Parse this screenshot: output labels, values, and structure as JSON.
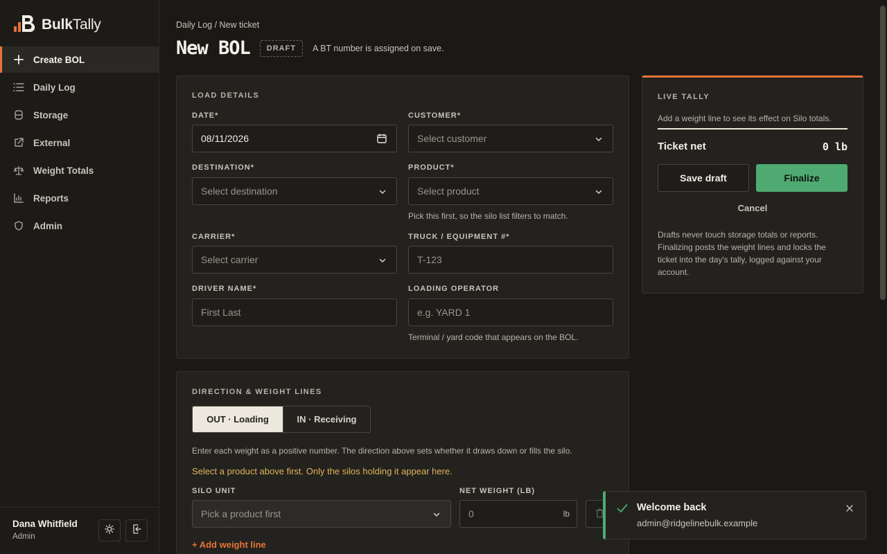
{
  "app": {
    "brand_bold": "Bulk",
    "brand_light": "Tally",
    "logo_icon": "bulktally-logo"
  },
  "nav": {
    "items": [
      {
        "label": "Create BOL",
        "icon": "plus-icon",
        "active": true
      },
      {
        "label": "Daily Log",
        "icon": "list-icon"
      },
      {
        "label": "Storage",
        "icon": "database-icon"
      },
      {
        "label": "External",
        "icon": "external-link-icon"
      },
      {
        "label": "Weight Totals",
        "icon": "scale-icon"
      },
      {
        "label": "Reports",
        "icon": "bar-chart-icon"
      },
      {
        "label": "Admin",
        "icon": "shield-icon"
      }
    ]
  },
  "user": {
    "name": "Dana Whitfield",
    "role": "Admin"
  },
  "page": {
    "breadcrumb": "Daily Log / New ticket",
    "title": "New BOL",
    "badge": "DRAFT",
    "note": "A BT number is assigned on save."
  },
  "load": {
    "section_title": "LOAD DETAILS",
    "date_label": "DATE*",
    "date_value": "08/11/2026",
    "customer_label": "CUSTOMER*",
    "customer_placeholder": "Select customer",
    "destination_label": "DESTINATION*",
    "destination_placeholder": "Select destination",
    "product_label": "PRODUCT*",
    "product_placeholder": "Select product",
    "product_hint": "Pick this first, so the silo list filters to match.",
    "carrier_label": "CARRIER*",
    "carrier_placeholder": "Select carrier",
    "truck_label": "TRUCK / EQUIPMENT #*",
    "truck_placeholder": "T-123",
    "driver_label": "DRIVER NAME*",
    "driver_placeholder": "First Last",
    "operator_label": "LOADING OPERATOR",
    "operator_placeholder": "e.g. YARD 1",
    "operator_hint": "Terminal / yard code that appears on the BOL."
  },
  "weights": {
    "section_title": "DIRECTION & WEIGHT LINES",
    "out_label": "OUT · Loading",
    "in_label": "IN · Receiving",
    "instructions": "Enter each weight as a positive number. The direction above sets whether it draws down or fills the silo.",
    "warning": "Select a product above first. Only the silos holding it appear here.",
    "silo_label": "SILO UNIT",
    "silo_placeholder": "Pick a product first",
    "net_label": "NET WEIGHT (LB)",
    "net_placeholder": "0",
    "net_unit": "lb",
    "add_line": "+ Add weight line"
  },
  "tally": {
    "title": "LIVE TALLY",
    "subtitle": "Add a weight line to see its effect on Silo totals.",
    "net_label": "Ticket net",
    "net_value": "0 lb",
    "save_draft": "Save draft",
    "finalize": "Finalize",
    "cancel": "Cancel",
    "footnote": "Drafts never touch storage totals or reports. Finalizing posts the weight lines and locks the ticket into the day's tally, logged against your account."
  },
  "toast": {
    "title": "Welcome back",
    "message": "admin@ridgelinebulk.example"
  },
  "colors": {
    "accent": "#e8733a",
    "success": "#4faa72",
    "warning": "#e0b35a"
  }
}
